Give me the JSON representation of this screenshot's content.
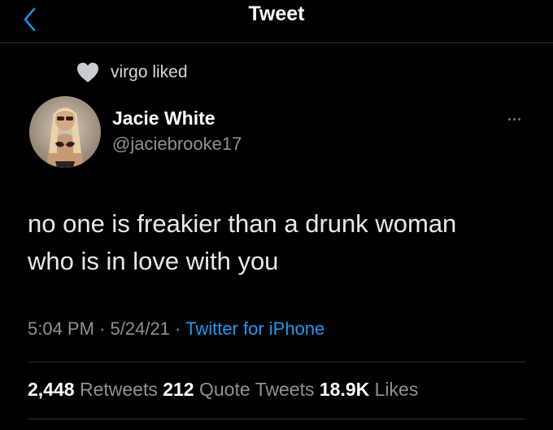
{
  "header": {
    "title": "Tweet",
    "back_icon": "chevron-left-icon"
  },
  "social_context": {
    "icon": "heart-icon",
    "text": "virgo liked"
  },
  "author": {
    "display_name": "Jacie White",
    "handle": "@jaciebrooke17"
  },
  "tweet": {
    "text_line_1": "no one is freakier than a drunk woman",
    "text_line_2": "who is in love with you"
  },
  "meta": {
    "time": "5:04 PM",
    "separator": "·",
    "date": "5/24/21",
    "source": "Twitter for iPhone"
  },
  "stats": {
    "retweets_count": "2,448",
    "retweets_label": "Retweets",
    "quotes_count": "212",
    "quotes_label": "Quote Tweets",
    "likes_count": "18.9K",
    "likes_label": "Likes"
  },
  "colors": {
    "background": "#000000",
    "link_blue": "#1d9bf0",
    "muted_text": "#8b9298",
    "divider": "#2a2d30"
  }
}
